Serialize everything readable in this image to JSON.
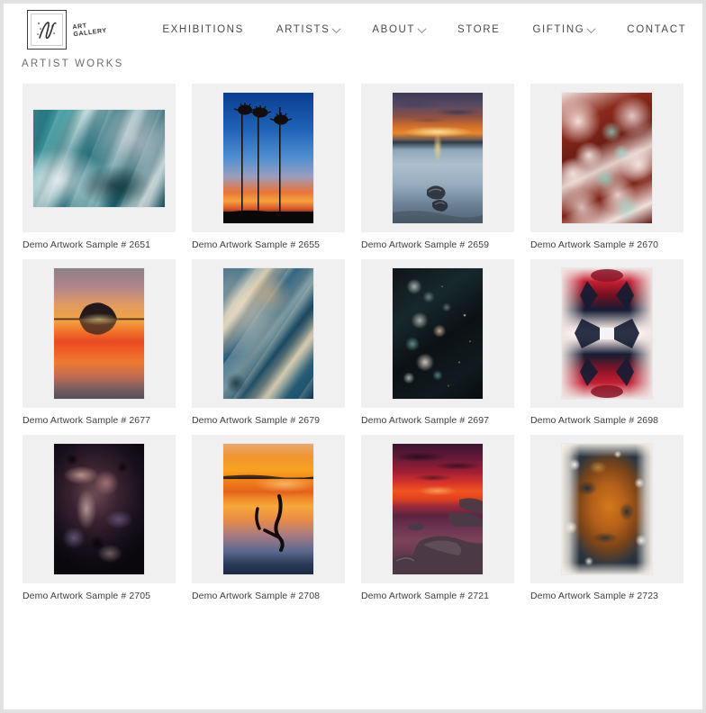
{
  "brand": {
    "logo_line1": "ART",
    "logo_line2": "GALLERY",
    "logo_icon": "gallery-frame-logo"
  },
  "nav": {
    "items": [
      {
        "label": "EXHIBITIONS",
        "has_dropdown": false
      },
      {
        "label": "ARTISTS",
        "has_dropdown": true
      },
      {
        "label": "ABOUT",
        "has_dropdown": true
      },
      {
        "label": "STORE",
        "has_dropdown": false
      },
      {
        "label": "GIFTING",
        "has_dropdown": true
      },
      {
        "label": "CONTACT",
        "has_dropdown": false
      }
    ],
    "icons": [
      {
        "name": "search-icon"
      },
      {
        "name": "cart-icon"
      }
    ]
  },
  "page": {
    "title": "ARTIST WORKS"
  },
  "gallery": {
    "items": [
      {
        "caption": "Demo Artwork Sample # 2651",
        "orientation": "landscape",
        "style": "teal-marble"
      },
      {
        "caption": "Demo Artwork Sample # 2655",
        "orientation": "portrait",
        "style": "palm-sunset"
      },
      {
        "caption": "Demo Artwork Sample # 2659",
        "orientation": "portrait",
        "style": "ocean-sunset-rocks"
      },
      {
        "caption": "Demo Artwork Sample # 2670",
        "orientation": "portrait",
        "style": "rust-cream-pour"
      },
      {
        "caption": "Demo Artwork Sample # 2677",
        "orientation": "portrait",
        "style": "island-sunset"
      },
      {
        "caption": "Demo Artwork Sample # 2679",
        "orientation": "portrait",
        "style": "blue-cream-swirl"
      },
      {
        "caption": "Demo Artwork Sample # 2697",
        "orientation": "portrait",
        "style": "dark-teal-bubbles"
      },
      {
        "caption": "Demo Artwork Sample # 2698",
        "orientation": "portrait",
        "style": "red-navy-symmetry"
      },
      {
        "caption": "Demo Artwork Sample # 2705",
        "orientation": "portrait",
        "style": "dark-plum-flow"
      },
      {
        "caption": "Demo Artwork Sample # 2708",
        "orientation": "portrait",
        "style": "driftwood-sunset"
      },
      {
        "caption": "Demo Artwork Sample # 2721",
        "orientation": "portrait",
        "style": "crimson-shore"
      },
      {
        "caption": "Demo Artwork Sample # 2723",
        "orientation": "portrait",
        "style": "amber-cream-pour"
      }
    ]
  },
  "colors": {
    "page_background": "#ffffff",
    "outer_background": "#e2e2e2",
    "card_background": "#f0f0f0",
    "nav_text": "#4a4a4a",
    "title_text": "#6d6d6d",
    "caption_text": "#3c3c3c"
  }
}
